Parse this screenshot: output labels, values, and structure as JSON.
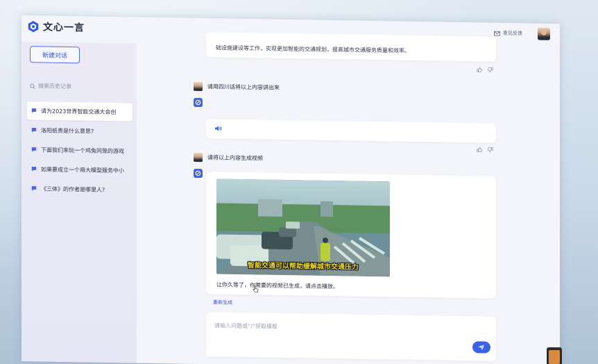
{
  "app": {
    "title": "文心一言",
    "feedback_label": "意见反馈"
  },
  "sidebar": {
    "new_chat_label": "新建对话",
    "search_placeholder": "搜索历史记录",
    "history": [
      {
        "label": "请为2023世界智能交通大会创",
        "active": true
      },
      {
        "label": "洛阳纸贵是什么意思?",
        "active": false
      },
      {
        "label": "下面我们来玩一个鸡兔同笼的游戏",
        "active": false
      },
      {
        "label": "如果要成立一个用大模型服务中小",
        "active": false
      },
      {
        "label": "《三体》的作者是哪里人?",
        "active": false
      }
    ]
  },
  "chat": {
    "prev_answer_tail": "础设施建设等工作，实现更加智能的交通规划，提高城市交通服务质量和效率。",
    "user_msg_1": "请用四川话将以上内容讲出来",
    "user_msg_2": "请将以上内容生成视频",
    "video_caption": "智能交通可以帮助缓解城市交通压力",
    "video_done_text": "让你久等了，你需要的视频已生成，请点击播放。",
    "regenerate_label": "重新生成"
  },
  "input": {
    "placeholder": "请输入问题或“/”获取模板"
  },
  "colors": {
    "accent": "#3a63e8",
    "active_item_bg": "#ffffff",
    "sidebar_bg": "#e8e8f6"
  },
  "icons": {
    "logo": "wenxin-logo-icon",
    "feedback": "mail-icon",
    "search": "search-icon",
    "history": "chat-bubble-icon",
    "like": "thumbs-up-icon",
    "dislike": "thumbs-down-icon",
    "audio": "speaker-icon",
    "send": "paper-plane-icon"
  }
}
